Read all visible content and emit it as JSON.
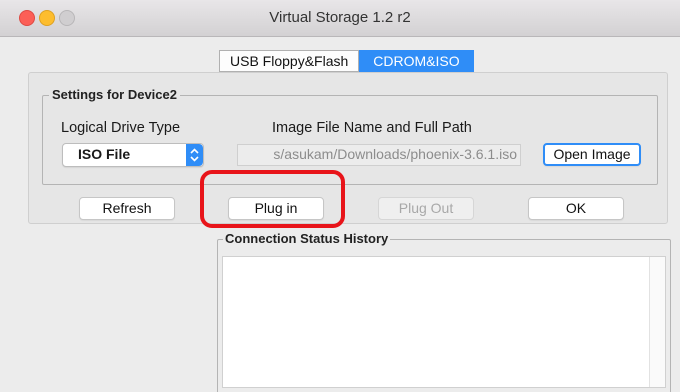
{
  "window": {
    "title": "Virtual Storage 1.2 r2"
  },
  "tabs": [
    {
      "label": "USB Floppy&Flash",
      "active": false
    },
    {
      "label": "CDROM&ISO",
      "active": true
    }
  ],
  "device_settings": {
    "group_title": "Settings for Device2",
    "drive_type_label": "Logical Drive Type",
    "drive_type_value": "ISO File",
    "image_path_label": "Image File Name and Full Path",
    "image_path_value": "s/asukam/Downloads/phoenix-3.6.1.iso",
    "open_image_label": "Open Image"
  },
  "actions": {
    "refresh_label": "Refresh",
    "plug_in_label": "Plug in",
    "plug_out_label": "Plug Out",
    "ok_label": "OK"
  },
  "status": {
    "title": "Connection Status History"
  },
  "colors": {
    "accent": "#2f8df7",
    "highlight": "#e8141a"
  }
}
